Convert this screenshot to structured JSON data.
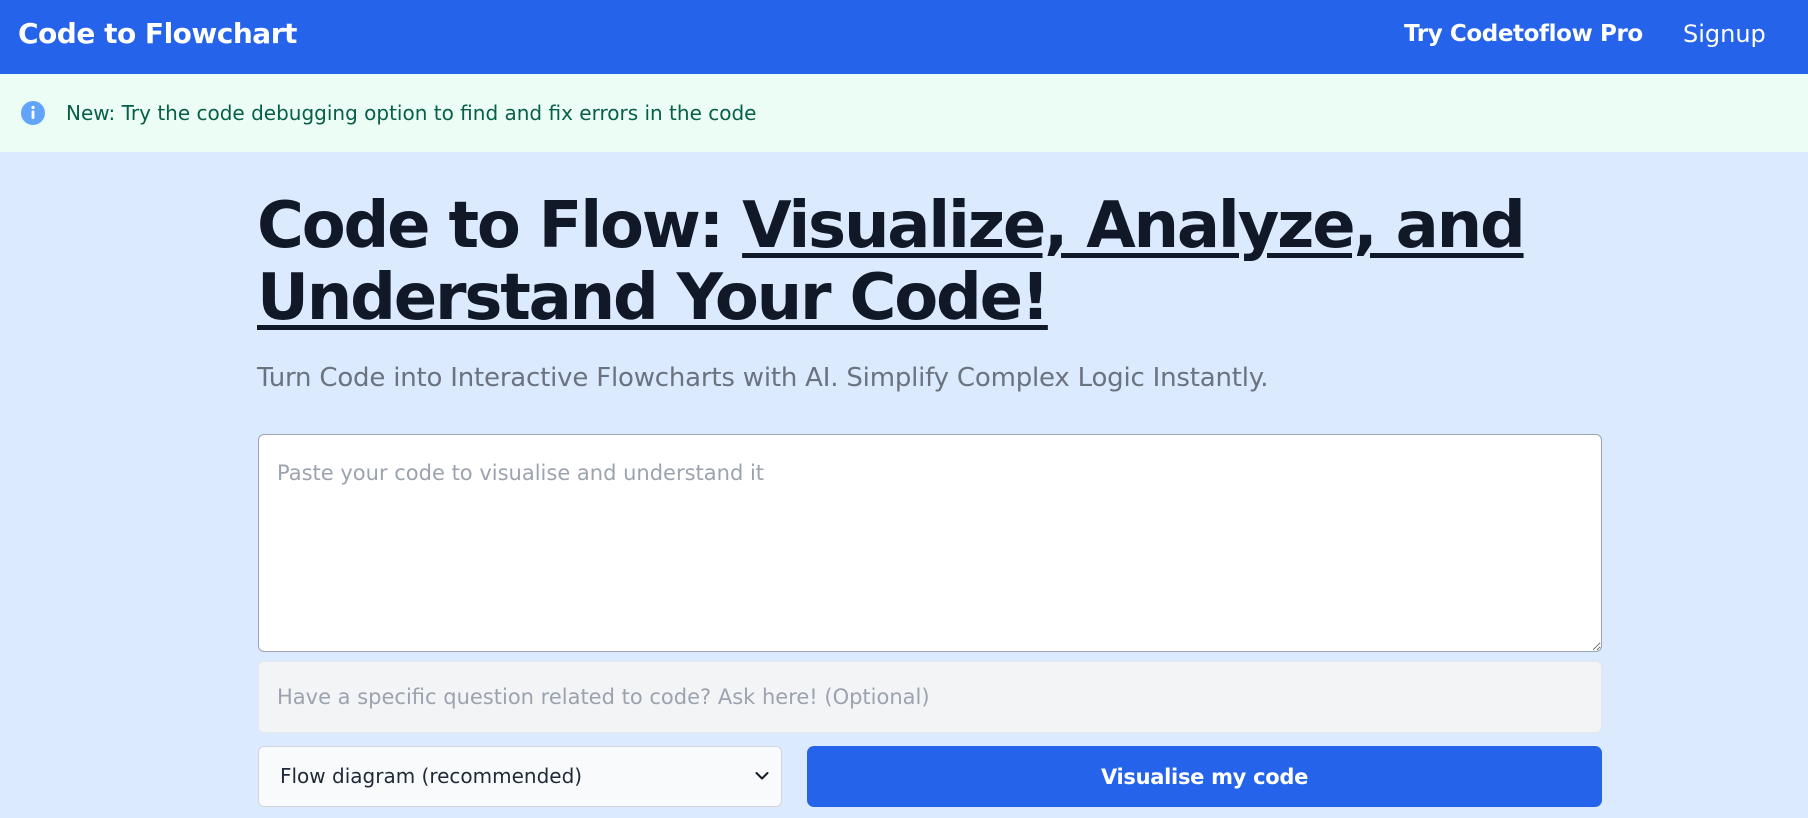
{
  "header": {
    "brand": "Code to Flowchart",
    "nav": {
      "pro": "Try Codetoflow Pro",
      "signup": "Signup"
    }
  },
  "banner": {
    "icon": "info-icon",
    "text": "New: Try the code debugging option to find and fix errors in the code"
  },
  "hero": {
    "title_plain": "Code to Flow: ",
    "title_underlined": "Visualize, Analyze, and Understand Your Code!",
    "subtitle": "Turn Code into Interactive Flowcharts with AI. Simplify Complex Logic Instantly."
  },
  "form": {
    "code_placeholder": "Paste your code to visualise and understand it",
    "code_value": "",
    "question_placeholder": "Have a specific question related to code? Ask here! (Optional)",
    "question_value": "",
    "diagram_type_selected": "Flow diagram (recommended)",
    "submit_label": "Visualise my code"
  },
  "colors": {
    "primary": "#2563eb",
    "page_background": "#dbeafe",
    "banner_background": "#ecfdf5",
    "banner_text": "#065f46",
    "title_text": "#111827",
    "subtitle_text": "#6b7280"
  }
}
